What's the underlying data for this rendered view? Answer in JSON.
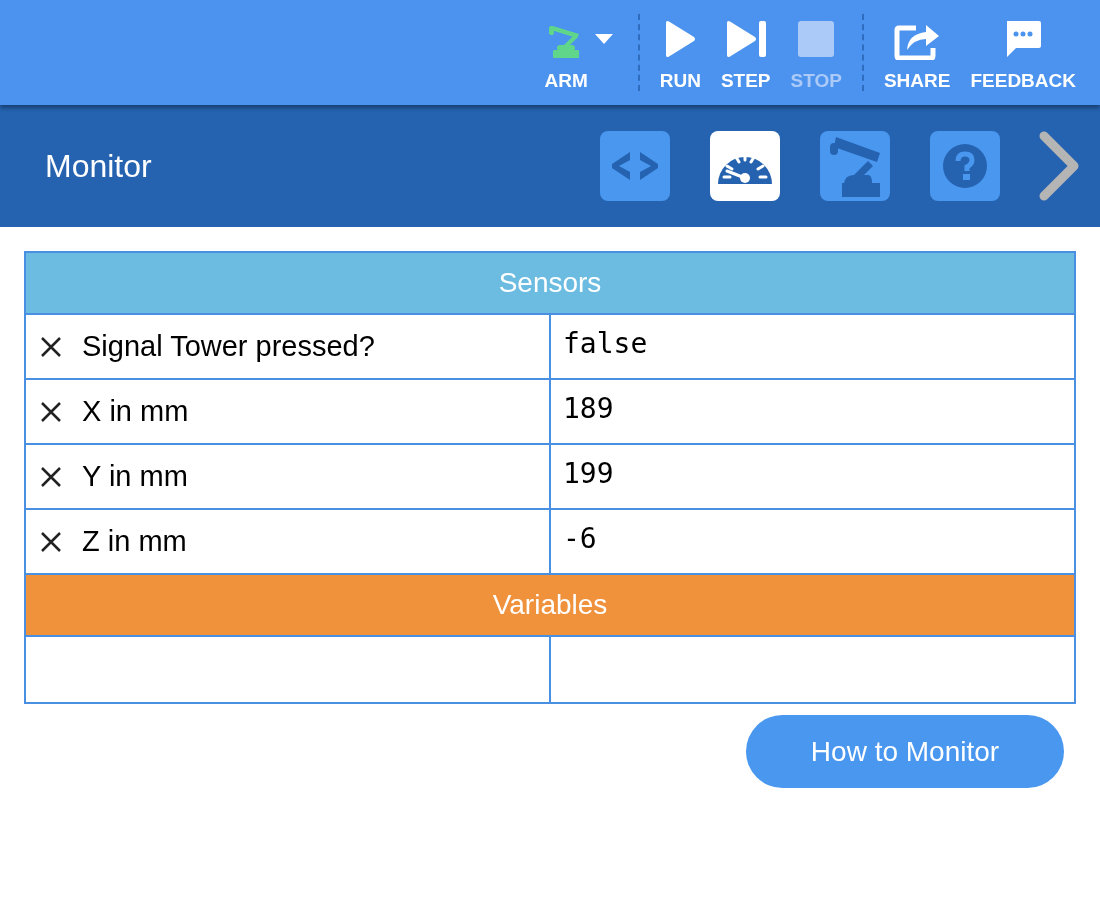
{
  "toolbar": {
    "groups": [
      [
        {
          "kind": "arm",
          "label": "ARM",
          "disabled": false
        }
      ],
      [
        {
          "kind": "run",
          "label": "RUN",
          "disabled": false
        },
        {
          "kind": "step",
          "label": "STEP",
          "disabled": false
        },
        {
          "kind": "stop",
          "label": "STOP",
          "disabled": true
        }
      ],
      [
        {
          "kind": "share",
          "label": "SHARE",
          "disabled": false
        },
        {
          "kind": "feedback",
          "label": "FEEDBACK",
          "disabled": false
        }
      ]
    ]
  },
  "panel": {
    "title": "Monitor",
    "tabs": [
      {
        "kind": "code",
        "selected": false
      },
      {
        "kind": "monitor",
        "selected": true
      },
      {
        "kind": "arm",
        "selected": false
      },
      {
        "kind": "help",
        "selected": false
      }
    ]
  },
  "sections": [
    {
      "title": "Sensors",
      "color": "#6bbce0",
      "rows": [
        {
          "label": "Signal Tower pressed?",
          "value": "false"
        },
        {
          "label": "X in mm",
          "value": "189"
        },
        {
          "label": "Y in mm",
          "value": "199"
        },
        {
          "label": "Z in mm",
          "value": "-6"
        }
      ]
    },
    {
      "title": "Variables",
      "color": "#f0913c"
    }
  ],
  "help_button": "How to Monitor"
}
